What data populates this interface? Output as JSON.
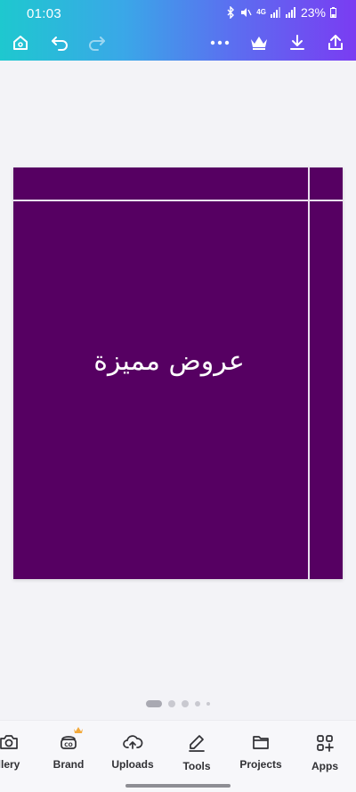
{
  "status_bar": {
    "time": "01:03",
    "battery": "23%",
    "network_label": "4G"
  },
  "toolbar": {
    "home_icon": "home-icon",
    "undo_icon": "undo-icon",
    "redo_icon": "redo-icon",
    "more_icon": "more-horizontal-icon",
    "premium_icon": "crown-icon",
    "download_icon": "download-icon",
    "share_icon": "share-icon"
  },
  "design": {
    "background_color": "#560062",
    "text": "عروض مميزة"
  },
  "pager": {
    "active_index": 0,
    "count": 5
  },
  "bottom_nav": {
    "items": [
      {
        "label": "llery",
        "icon": "camera-icon"
      },
      {
        "label": "Brand",
        "icon": "brand-kit-icon"
      },
      {
        "label": "Uploads",
        "icon": "cloud-upload-icon"
      },
      {
        "label": "Tools",
        "icon": "pen-tool-icon"
      },
      {
        "label": "Projects",
        "icon": "folder-icon"
      },
      {
        "label": "Apps",
        "icon": "apps-grid-icon"
      }
    ]
  },
  "colors": {
    "header_gradient_start": "#1ec8cf",
    "header_gradient_end": "#7a3cf2",
    "premium_crown": "#f2a93b"
  }
}
